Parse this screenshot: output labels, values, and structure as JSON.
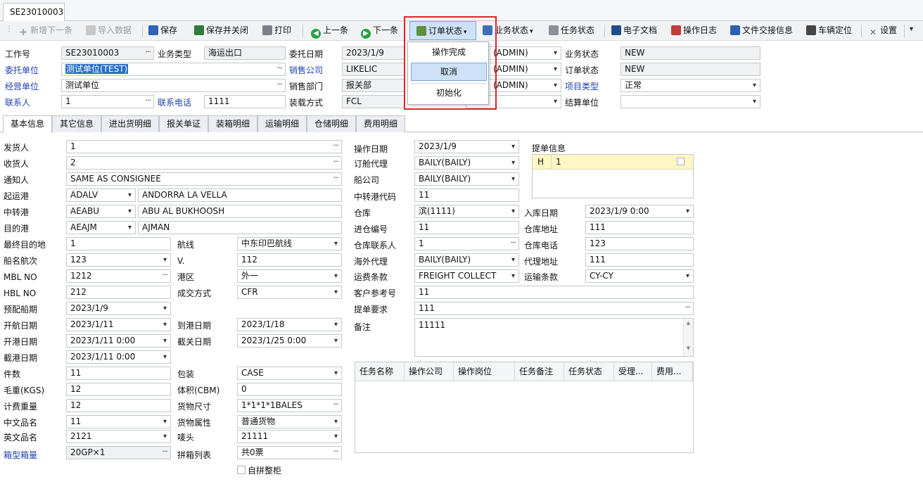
{
  "doc_tab": "SE23010003",
  "toolbar": [
    {
      "id": "add-next",
      "label": "新增下一条",
      "icon": "plus-icon",
      "disabled": true
    },
    {
      "id": "import",
      "label": "导入数据",
      "icon": "import-icon",
      "disabled": true
    },
    {
      "id": "save",
      "label": "保存",
      "icon": "save-icon",
      "disabled": false
    },
    {
      "id": "save-close",
      "label": "保存并关闭",
      "icon": "save-close-icon",
      "disabled": false
    },
    {
      "id": "print",
      "label": "打印",
      "icon": "printer-icon",
      "disabled": false
    },
    {
      "id": "prev",
      "label": "上一条",
      "icon": "arrow-left-icon",
      "disabled": false
    },
    {
      "id": "next",
      "label": "下一条",
      "icon": "arrow-right-icon",
      "disabled": false
    },
    {
      "id": "order-status",
      "label": "订单状态",
      "icon": "order-icon",
      "disabled": false
    },
    {
      "id": "biz-status",
      "label": "业务状态",
      "icon": "flow-icon",
      "disabled": false
    },
    {
      "id": "task-status",
      "label": "任务状态",
      "icon": "task-icon",
      "disabled": false
    },
    {
      "id": "edoc",
      "label": "电子文档",
      "icon": "document-icon",
      "disabled": false
    },
    {
      "id": "oplog",
      "label": "操作日志",
      "icon": "chart-icon",
      "disabled": false
    },
    {
      "id": "handover",
      "label": "文件交接信息",
      "icon": "file-transfer-icon",
      "disabled": false
    },
    {
      "id": "vehicle",
      "label": "车辆定位",
      "icon": "truck-icon",
      "disabled": false
    },
    {
      "id": "settings",
      "label": "设置",
      "icon": "tools-icon",
      "disabled": false
    }
  ],
  "dropdown": {
    "items": [
      "操作完成",
      "取消",
      "初始化"
    ],
    "highlighted": 1
  },
  "header": {
    "job_no_label": "工作号",
    "job_no": "SE23010003",
    "biz_type_label": "业务类型",
    "biz_type": "海运出口",
    "entrust_date_label": "委托日期",
    "entrust_date": "2023/1/9",
    "admin_1": "(ADMIN)",
    "biz_status_label": "业务状态",
    "biz_status": "NEW",
    "client_label": "委托单位",
    "client": "测试单位(TEST)",
    "sales_company_label": "销售公司",
    "sales_company": "LIKELIC",
    "admin_2": "(ADMIN)",
    "order_status_label": "订单状态",
    "order_status": "NEW",
    "operator_unit_label": "经营单位",
    "operator_unit": "测试单位",
    "sales_dept_label": "销售部门",
    "sales_dept": "报关部",
    "admin_3": "(ADMIN)",
    "project_type_label": "项目类型",
    "project_type": "正常",
    "contact_label": "联系人",
    "contact": "1",
    "phone_label": "联系电话",
    "phone": "1111",
    "load_mode_label": "装载方式",
    "load_mode": "FCL",
    "settle_label": "结算单位",
    "settle": ""
  },
  "tabs": [
    "基本信息",
    "其它信息",
    "进出货明细",
    "报关单证",
    "装箱明细",
    "运输明细",
    "仓储明细",
    "费用明细"
  ],
  "basic": {
    "shipper_label": "发货人",
    "shipper": "1",
    "consignee_label": "收货人",
    "consignee": "2",
    "notify_label": "通知人",
    "notify": "SAME AS CONSIGNEE",
    "pol_label": "起运港",
    "pol_code": "ADALV",
    "pol_name": "ANDORRA LA VELLA",
    "via_label": "中转港",
    "via_code": "AEABU",
    "via_name": "ABU AL BUKHOOSH",
    "pod_label": "目的港",
    "pod_code": "AEAJM",
    "pod_name": "AJMAN",
    "final_dest_label": "最终目的地",
    "final_dest": "1",
    "route_label": "航线",
    "route": "中东印巴航线",
    "vessel_label": "船名航次",
    "vessel": "123",
    "voyage_label": "V.",
    "voyage": "112",
    "mbl_label": "MBL NO",
    "mbl": "1212",
    "port_area_label": "港区",
    "port_area": "外一",
    "hbl_label": "HBL NO",
    "hbl": "212",
    "deal_label": "成交方式",
    "deal": "CFR",
    "etd_pre_label": "预配船期",
    "etd_pre": "2023/1/9",
    "sail_label": "开航日期",
    "sail": "2023/1/11",
    "arrive_label": "到港日期",
    "arrive": "2023/1/18",
    "open_label": "开港日期",
    "open": "2023/1/11 0:00",
    "customs_cut_label": "截关日期",
    "customs_cut": "2023/1/25 0:00",
    "port_cut_label": "截港日期",
    "port_cut": "2023/1/11 0:00",
    "pieces_label": "件数",
    "pieces": "11",
    "pack_label": "包装",
    "pack": "CASE",
    "gw_label": "毛重(KGS)",
    "gw": "12",
    "cbm_label": "体积(CBM)",
    "cbm": "0",
    "cw_label": "计费重量",
    "cw": "12",
    "dim_label": "货物尺寸",
    "dim": "1*1*1*1BALES",
    "cn_name_label": "中文品名",
    "cn_name": "11",
    "attr_label": "货物属性",
    "attr": "普通货物",
    "en_name_label": "英文品名",
    "en_name": "2121",
    "mark_label": "唛头",
    "mark": "21111",
    "container_label": "箱型箱量",
    "container": "20GP×1",
    "consol_label": "拼箱列表",
    "consol": "共0票",
    "full_cabinet_label": "自拼整柜",
    "op_date_label": "操作日期",
    "op_date": "2023/1/9",
    "booking_agent_label": "订舱代理",
    "booking_agent": "BAILY(BAILY)",
    "carrier_label": "船公司",
    "carrier": "BAILY(BAILY)",
    "via_code_label": "中转港代码",
    "via_code2": "11",
    "warehouse_label": "仓库",
    "warehouse": "滨(1111)",
    "in_date_label": "入库日期",
    "in_date": "2023/1/9 0:00",
    "entry_no_label": "进仓编号",
    "entry_no": "11",
    "wh_addr_label": "仓库地址",
    "wh_addr": "111",
    "wh_contact_label": "仓库联系人",
    "wh_contact": "1",
    "wh_phone_label": "仓库电话",
    "wh_phone": "123",
    "overseas_label": "海外代理",
    "overseas": "BAILY(BAILY)",
    "agent_addr_label": "代理地址",
    "agent_addr": "111",
    "freight_label": "运费条款",
    "freight": "FREIGHT COLLECT",
    "transport_label": "运输条款",
    "transport": "CY-CY",
    "cust_ref_label": "客户参考号",
    "cust_ref": "11",
    "bl_req_label": "提单要求",
    "bl_req": "111",
    "remark_label": "备注",
    "remark": "11111",
    "bl_info_label": "提单信息",
    "bl_code": "H",
    "bl_val": "1"
  },
  "task_grid": {
    "columns": [
      "任务名称",
      "操作公司",
      "操作岗位",
      "任务备注",
      "任务状态",
      "受理...",
      "费用..."
    ]
  }
}
